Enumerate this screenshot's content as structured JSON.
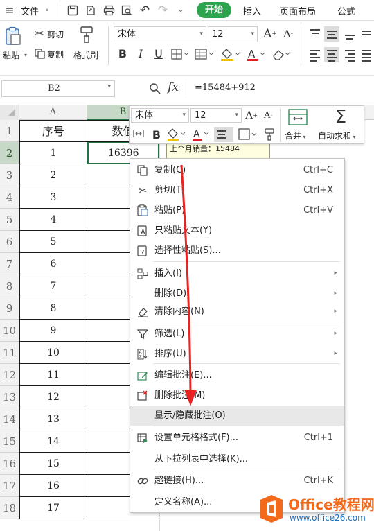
{
  "menubar": {
    "file_label": "文件",
    "tabs": [
      "开始",
      "插入",
      "页面布局",
      "公式"
    ],
    "active_tab": "开始"
  },
  "ribbon": {
    "paste_label": "粘贴",
    "cut_label": "剪切",
    "copy_label": "复制",
    "format_painter_label": "格式刷",
    "font_name": "宋体",
    "font_size": "12",
    "bold": "B",
    "italic": "I",
    "underline": "U",
    "font_color_letter": "A"
  },
  "formula_bar": {
    "name_box": "B2",
    "fx_label": "fx",
    "formula": "=15484+912"
  },
  "grid": {
    "columns": [
      "A",
      "B"
    ],
    "header_row": {
      "A": "序号",
      "B": "数值"
    },
    "rows": [
      {
        "row": "1"
      },
      {
        "row": "2",
        "A": "1",
        "B": "16396"
      },
      {
        "row": "3",
        "A": "2"
      },
      {
        "row": "4",
        "A": "3"
      },
      {
        "row": "5",
        "A": "4"
      },
      {
        "row": "6",
        "A": "5"
      },
      {
        "row": "7",
        "A": "6"
      },
      {
        "row": "8",
        "A": "7"
      },
      {
        "row": "9",
        "A": "8"
      },
      {
        "row": "10",
        "A": "9"
      },
      {
        "row": "11",
        "A": "10"
      },
      {
        "row": "12",
        "A": "11"
      },
      {
        "row": "13",
        "A": "12"
      },
      {
        "row": "14",
        "A": "13"
      },
      {
        "row": "15",
        "A": "14"
      },
      {
        "row": "16",
        "A": "15"
      },
      {
        "row": "17",
        "A": "16"
      },
      {
        "row": "18",
        "A": "17"
      }
    ]
  },
  "mini_toolbar": {
    "font_name": "宋体",
    "font_size": "12",
    "bold": "B",
    "font_color_letter": "A",
    "merge_label": "合并",
    "autosum_label": "自动求和"
  },
  "comment": {
    "line1": "上个月销量：15484"
  },
  "context_menu": {
    "items": [
      {
        "label": "复制(C)",
        "shortcut": "Ctrl+C",
        "icon": "copy-icon"
      },
      {
        "label": "剪切(T)",
        "shortcut": "Ctrl+X",
        "icon": "scissors-icon"
      },
      {
        "label": "粘贴(P)",
        "shortcut": "Ctrl+V",
        "icon": "paste-icon"
      },
      {
        "label": "只粘贴文本(Y)",
        "shortcut": "",
        "icon": "paste-text-icon"
      },
      {
        "label": "选择性粘贴(S)...",
        "shortcut": "",
        "icon": "paste-special-icon"
      },
      {
        "label": "插入(I)",
        "shortcut": "",
        "icon": "insert-icon"
      },
      {
        "label": "删除(D)",
        "shortcut": "",
        "icon": ""
      },
      {
        "label": "清除内容(N)",
        "shortcut": "",
        "icon": "eraser-icon"
      },
      {
        "label": "筛选(L)",
        "shortcut": "",
        "icon": "filter-icon"
      },
      {
        "label": "排序(U)",
        "shortcut": "",
        "icon": "sort-icon"
      },
      {
        "label": "编辑批注(E)...",
        "shortcut": "",
        "icon": "edit-comment-icon"
      },
      {
        "label": "删除批注(M)",
        "shortcut": "",
        "icon": "delete-comment-icon"
      },
      {
        "label": "显示/隐藏批注(O)",
        "shortcut": "",
        "icon": ""
      },
      {
        "label": "设置单元格格式(F)...",
        "shortcut": "Ctrl+1",
        "icon": "format-cells-icon"
      },
      {
        "label": "从下拉列表中选择(K)...",
        "shortcut": "",
        "icon": ""
      },
      {
        "label": "超链接(H)...",
        "shortcut": "Ctrl+K",
        "icon": "link-icon"
      },
      {
        "label": "定义名称(A)...",
        "shortcut": "",
        "icon": ""
      }
    ]
  },
  "watermark": {
    "brand": "Office教程网",
    "url": "www.office26.com"
  },
  "colors": {
    "active_tab_bg": "#2ea44f",
    "selection_green": "#217346",
    "arrow_red": "#e82323",
    "logo_orange": "#f26b1d",
    "logo_blue": "#1a6fc4"
  }
}
